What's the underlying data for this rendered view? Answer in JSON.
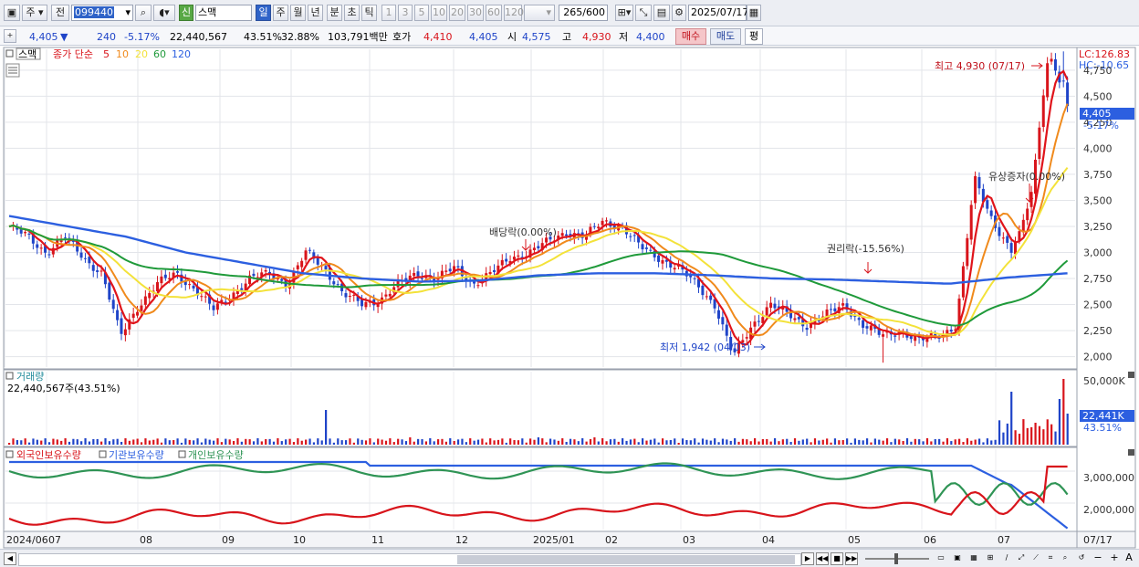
{
  "toolbar": {
    "market_label": "주",
    "prev_label": "전",
    "code": "099440",
    "badge_label": "신",
    "stock_name": "스맥",
    "period_buttons": [
      "일",
      "주",
      "월",
      "년",
      "분",
      "초",
      "틱"
    ],
    "interval_buttons": [
      "1",
      "3",
      "5",
      "10",
      "20",
      "30",
      "60",
      "120"
    ],
    "count": "265",
    "count_max": "/600",
    "date": "2025/07/17"
  },
  "quote": {
    "price": "4,405",
    "arrow": "▼",
    "change": "240",
    "change_pct": "-5.17%",
    "volume": "22,440,567",
    "volume_pct": "43.51%",
    "turnover": "32.88%",
    "amount": "103,791백만",
    "bid_label": "호가",
    "bid1": "4,410",
    "bid2": "4,405",
    "open_label": "시",
    "open": "4,575",
    "high_label": "고",
    "high": "4,930",
    "low_label": "저",
    "low": "4,400",
    "buy_label": "매수",
    "sell_label": "매도",
    "eval_label": "평"
  },
  "colors": {
    "up": "#d8141b",
    "down": "#1f44c8",
    "ma5": "#e0141b",
    "ma10": "#f08a1c",
    "ma20": "#f3e23a",
    "ma60": "#1f9a3a",
    "ma120": "#2c5fe0",
    "inst": "#2f9455"
  },
  "price_panel": {
    "legend_name": "스맥",
    "legend_series": [
      {
        "label": "종가 단순",
        "color": "#d8141b"
      },
      {
        "label": "5",
        "color": "#d8141b"
      },
      {
        "label": "10",
        "color": "#f08a1c"
      },
      {
        "label": "20",
        "color": "#f3e23a"
      },
      {
        "label": "60",
        "color": "#1f9a3a"
      },
      {
        "label": "120",
        "color": "#2c5fe0"
      }
    ],
    "lc": "LC:126.83",
    "hc": "HC:-10.65",
    "y_ticks": [
      "4,750",
      "4,500",
      "4,250",
      "4,000",
      "3,750",
      "3,500",
      "3,250",
      "3,000",
      "2,750",
      "2,500",
      "2,250",
      "2,000"
    ],
    "current_price_tag": "4,405",
    "current_pct_tag": "-5.17%",
    "annotations": {
      "high": "최고 4,930 (07/17)",
      "low": "최저 1,942 (04/03)",
      "dividend": "배당락(0.00%)",
      "rights": "권리락(-15.56%)",
      "capital_increase": "유상증자(0.00%)"
    }
  },
  "volume_panel": {
    "title": "거래량",
    "value_text": "22,440,567주(43.51%)",
    "y_tick": "50,000K",
    "tag_value": "22,441K",
    "tag_pct": "43.51%"
  },
  "holdings_panel": {
    "legend": [
      "외국인보유수량",
      "기관보유수량",
      "개인보유수량"
    ],
    "y_ticks": [
      "3,000,000",
      "2,000,000"
    ]
  },
  "x_axis": {
    "labels": [
      "2024/06",
      "07",
      "08",
      "09",
      "10",
      "11",
      "12",
      "2025/01",
      "02",
      "03",
      "04",
      "05",
      "06",
      "07"
    ],
    "right_label": "07/17"
  },
  "chart_data": {
    "type": "line",
    "symbol": "스맥",
    "ylim": [
      1900,
      4950
    ],
    "months": [
      "2024/06",
      "07",
      "08",
      "09",
      "10",
      "11",
      "12",
      "2025/01",
      "02",
      "03",
      "04",
      "05",
      "06",
      "07"
    ],
    "close_keypoints": [
      3250,
      3150,
      3000,
      3150,
      2950,
      2800,
      2200,
      2500,
      2700,
      2800,
      2650,
      2450,
      2600,
      2750,
      2800,
      2700,
      3000,
      2850,
      2600,
      2500,
      2550,
      2700,
      2800,
      2750,
      2850,
      2700,
      2800,
      2950,
      3000,
      3100,
      3200,
      3150,
      3300,
      3250,
      3050,
      2950,
      2850,
      2700,
      2500,
      2000,
      2300,
      2500,
      2400,
      2300,
      2400,
      2500,
      2300,
      2200,
      2250,
      2150,
      2200,
      2300,
      3700,
      3300,
      3000,
      3500,
      4930,
      4405
    ],
    "ma120_keypoints": [
      3350,
      3250,
      3150,
      3000,
      2900,
      2800,
      2750,
      2720,
      2730,
      2780,
      2800,
      2800,
      2780,
      2750,
      2740,
      2720,
      2700,
      2760,
      2800
    ]
  }
}
